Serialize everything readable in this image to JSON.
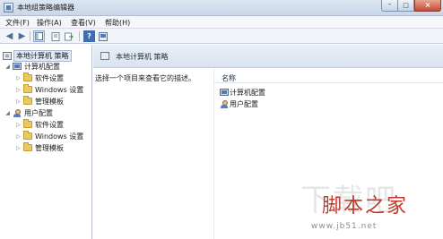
{
  "window": {
    "title": "本地组策略编辑器",
    "min_glyph": "–",
    "max_glyph": "□",
    "close_glyph": "×"
  },
  "menu": {
    "items": [
      {
        "label": "文件(F)"
      },
      {
        "label": "操作(A)"
      },
      {
        "label": "查看(V)"
      },
      {
        "label": "帮助(H)"
      }
    ]
  },
  "toolbar": {
    "icons": [
      "back-icon",
      "forward-icon",
      "show-tree-icon",
      "properties-icon",
      "export-icon",
      "help-icon",
      "console-icon"
    ],
    "back_glyph": "◀",
    "forward_glyph": "▶",
    "help_glyph": "?"
  },
  "tree": {
    "root": {
      "label": "本地计算机 策略",
      "selected": true
    },
    "computer": {
      "label": "计算机配置",
      "children": [
        {
          "label": "软件设置"
        },
        {
          "label": "Windows 设置"
        },
        {
          "label": "管理模板"
        }
      ]
    },
    "user": {
      "label": "用户配置",
      "children": [
        {
          "label": "软件设置"
        },
        {
          "label": "Windows 设置"
        },
        {
          "label": "管理模板"
        }
      ]
    },
    "expanded_glyph": "◢",
    "collapsed_glyph": "▷"
  },
  "main": {
    "header_title": "本地计算机 策略",
    "description": "选择一个项目来查看它的描述。",
    "column_name": "名称",
    "items": [
      {
        "label": "计算机配置",
        "icon": "computer-icon"
      },
      {
        "label": "用户配置",
        "icon": "user-icon"
      }
    ]
  },
  "watermark": {
    "brand": "脚本之家",
    "url": "www.jb51.net",
    "ghost": "下载吧"
  }
}
